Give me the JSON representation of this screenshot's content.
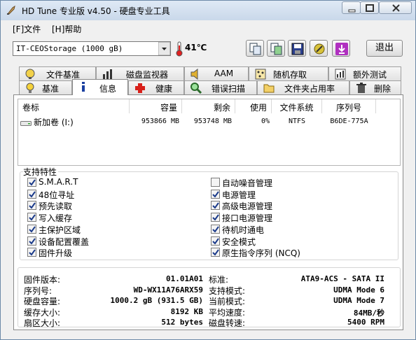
{
  "title": "HD Tune 专业版 v4.50 - 硬盘专业工具",
  "menu": {
    "file": "[F]文件",
    "help": "[H]帮助"
  },
  "drive": {
    "selected": "IT-CEOStorage (1000 gB)",
    "temperature": "41℃"
  },
  "exit_label": "退出",
  "tabs_row1": [
    "文件基准",
    "磁盘监视器",
    "AAM",
    "随机存取",
    "额外测试"
  ],
  "tabs_row2": [
    "基准",
    "信息",
    "健康",
    "错误扫描",
    "文件夹占用率",
    "删除"
  ],
  "active_tab": "信息",
  "volume_table": {
    "headers": [
      "卷标",
      "容量",
      "剩余",
      "使用",
      "文件系统",
      "序列号"
    ],
    "rows": [
      {
        "label": "新加卷 (I:)",
        "capacity": "953866 MB",
        "free": "953748 MB",
        "used": "0%",
        "fs": "NTFS",
        "serial": "B6DE-775A"
      }
    ]
  },
  "features": {
    "title": "支持特性",
    "left": [
      {
        "label": "S.M.A.R.T",
        "checked": true
      },
      {
        "label": "48位寻址",
        "checked": true
      },
      {
        "label": "预先读取",
        "checked": true
      },
      {
        "label": "写入缓存",
        "checked": true
      },
      {
        "label": "主保护区域",
        "checked": true
      },
      {
        "label": "设备配置覆盖",
        "checked": true
      },
      {
        "label": "固件升级",
        "checked": true
      }
    ],
    "right": [
      {
        "label": "自动噪音管理",
        "checked": false
      },
      {
        "label": "电源管理",
        "checked": true
      },
      {
        "label": "高级电源管理",
        "checked": true
      },
      {
        "label": "接口电源管理",
        "checked": true
      },
      {
        "label": "待机时通电",
        "checked": true
      },
      {
        "label": "安全模式",
        "checked": true
      },
      {
        "label": "原生指令序列 (NCQ)",
        "checked": true
      }
    ]
  },
  "info": {
    "left": [
      {
        "label": "固件版本:",
        "value": "01.01A01"
      },
      {
        "label": "序列号:",
        "value": "WD-WX11A76ARX59"
      },
      {
        "label": "硬盘容量:",
        "value": "1000.2 gB (931.5 GB)"
      },
      {
        "label": "缓存大小:",
        "value": "8192 KB"
      },
      {
        "label": "扇区大小:",
        "value": "512 bytes"
      }
    ],
    "right": [
      {
        "label": "标准:",
        "value": "ATA9-ACS - SATA II"
      },
      {
        "label": "支持模式:",
        "value": "UDMA Mode 6"
      },
      {
        "label": "当前模式:",
        "value": "UDMA Mode 7"
      },
      {
        "label": "平均速度:",
        "value": "84MB/秒"
      },
      {
        "label": "磁盘转速:",
        "value": "5400 RPM"
      }
    ]
  }
}
